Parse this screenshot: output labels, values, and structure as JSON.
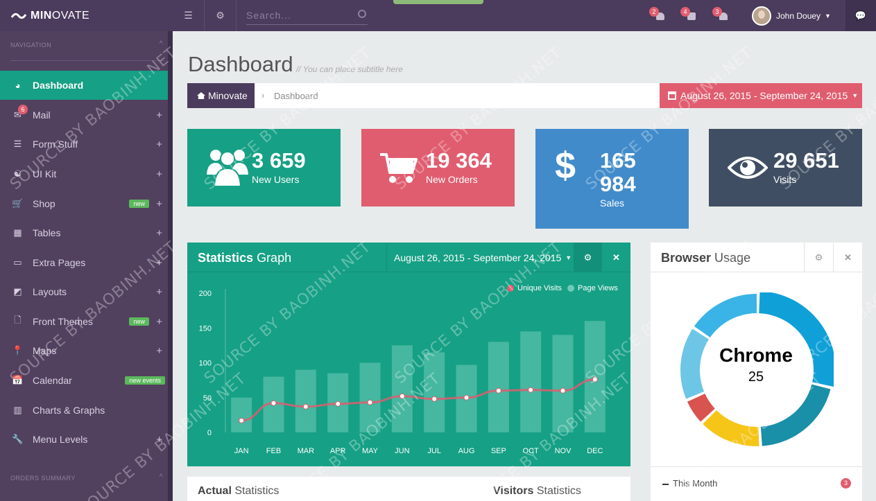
{
  "brand": {
    "name_bold": "MIN",
    "name_rest": "OVATE"
  },
  "topbar": {
    "search_placeholder": "Search...",
    "notifications": [
      {
        "icon": "user-icon",
        "count": "2"
      },
      {
        "icon": "envelope-icon",
        "count": "4"
      },
      {
        "icon": "bell-icon",
        "count": "3"
      }
    ],
    "user_name": "John Douey"
  },
  "sidebar": {
    "nav_heading": "NAVIGATION",
    "items": [
      {
        "label": "Dashboard",
        "icon": "dashboard-icon",
        "active": true
      },
      {
        "label": "Mail",
        "icon": "mail-icon",
        "count": "6"
      },
      {
        "label": "Form Stuff",
        "icon": "list-icon"
      },
      {
        "label": "UI Kit",
        "icon": "ui-kit-icon"
      },
      {
        "label": "Shop",
        "icon": "cart-icon",
        "tag": "new"
      },
      {
        "label": "Tables",
        "icon": "table-icon"
      },
      {
        "label": "Extra Pages",
        "icon": "monitor-icon"
      },
      {
        "label": "Layouts",
        "icon": "layout-icon"
      },
      {
        "label": "Front Themes",
        "icon": "file-icon",
        "tag": "new"
      },
      {
        "label": "Maps",
        "icon": "map-marker-icon"
      },
      {
        "label": "Calendar",
        "icon": "calendar-icon",
        "tag": "new events"
      },
      {
        "label": "Charts & Graphs",
        "icon": "bar-chart-icon"
      },
      {
        "label": "Menu Levels",
        "icon": "wrench-icon"
      }
    ],
    "footer_heading": "ORDERS SUMMARY"
  },
  "page": {
    "title": "Dashboard",
    "subtitle": "// You can place subtitle here",
    "breadcrumb_home": "Minovate",
    "breadcrumb_current": "Dashboard",
    "date_range": "August 26, 2015 - September 24, 2015"
  },
  "tiles": [
    {
      "value": "3 659",
      "label": "New Users",
      "color": "#16a085",
      "icon": "users-icon"
    },
    {
      "value": "19 364",
      "label": "New Orders",
      "color": "#e05d6f",
      "icon": "cart-icon"
    },
    {
      "value": "165 984",
      "label": "Sales",
      "color": "#418bca",
      "icon": "dollar-icon"
    },
    {
      "value": "29 651",
      "label": "Visits",
      "color": "#3f4e62",
      "icon": "eye-icon"
    }
  ],
  "statistics": {
    "title_bold": "Statistics",
    "title_rest": "Graph",
    "date_range": "August 26, 2015 - September 24, 2015"
  },
  "chart_data": {
    "type": "bar",
    "categories": [
      "JAN",
      "FEB",
      "MAR",
      "APR",
      "MAY",
      "JUN",
      "JUL",
      "AUG",
      "SEP",
      "OCT",
      "NOV",
      "DEC"
    ],
    "series": [
      {
        "name": "Unique Visits",
        "type": "line",
        "color": "#e05d6f",
        "values": [
          17,
          42,
          37,
          41,
          43,
          52,
          48,
          50,
          60,
          61,
          60,
          76
        ]
      },
      {
        "name": "Page Views",
        "type": "bar",
        "color": "#6fcbb6",
        "values": [
          50,
          80,
          90,
          85,
          100,
          125,
          115,
          97,
          130,
          145,
          140,
          160
        ]
      }
    ],
    "ylim": [
      0,
      200
    ],
    "yticks": [
      0,
      50,
      100,
      150,
      200
    ],
    "legend": "top-right",
    "grid": false
  },
  "browser": {
    "title_bold": "Browser",
    "title_rest": "Usage",
    "center_name": "Chrome",
    "center_value": "25",
    "slices": [
      {
        "value": 25,
        "color": "#0fa0d8"
      },
      {
        "value": 18,
        "color": "#1a8fa8"
      },
      {
        "value": 12,
        "color": "#f5c518"
      },
      {
        "value": 5,
        "color": "#d9534f"
      },
      {
        "value": 14,
        "color": "#6ec6e6"
      },
      {
        "value": 14,
        "color": "#3ab4e6"
      }
    ],
    "footer_label": "This Month",
    "footer_badge": "3"
  },
  "bottom": {
    "actual_bold": "Actual",
    "actual_rest": "Statistics",
    "visitors_bold": "Visitors",
    "visitors_rest": "Statistics"
  },
  "watermark": "SOURCE BY BAOBINH.NET"
}
